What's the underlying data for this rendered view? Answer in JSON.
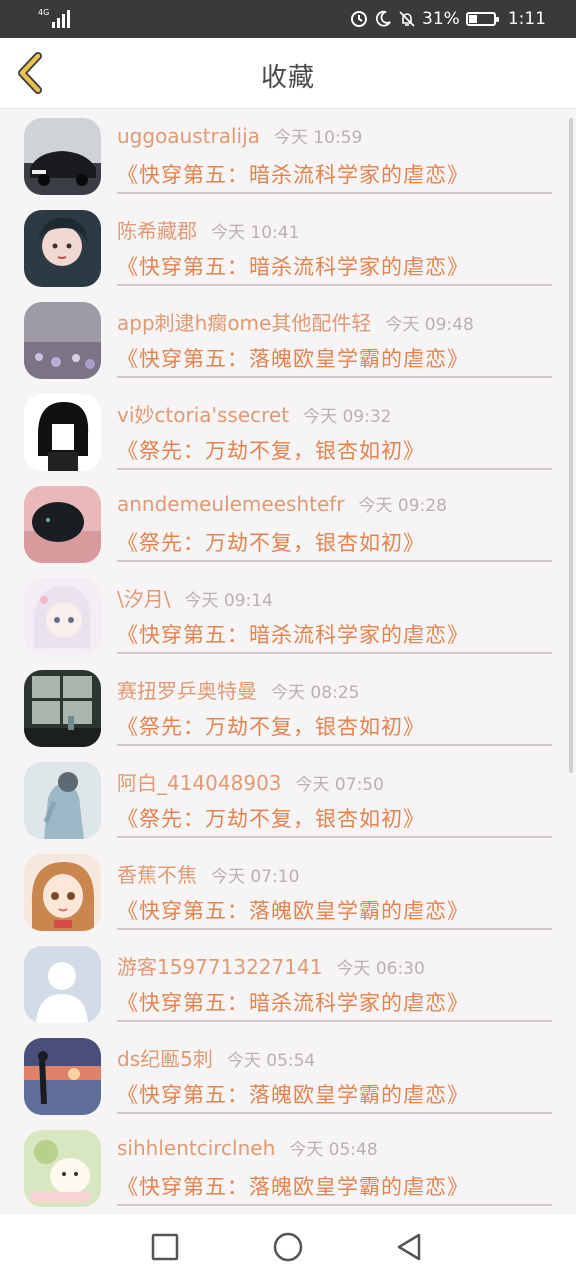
{
  "status_bar": {
    "network": "4G",
    "battery": "31%",
    "battery_level": 0.31,
    "time": "1:11",
    "icons": [
      "signal-icon",
      "data-saver-icon",
      "moon-icon",
      "mute-bell-icon",
      "battery-icon"
    ]
  },
  "header": {
    "title": "收藏",
    "back_icon": "chevron-left-icon"
  },
  "favorites": [
    {
      "user": "uggoaustralija",
      "time": "今天 10:59",
      "book": "《快穿第五：暗杀流科学家的虐恋》"
    },
    {
      "user": "陈希藏郡",
      "time": "今天 10:41",
      "book": "《快穿第五：暗杀流科学家的虐恋》"
    },
    {
      "user": "app刺逮h瘸ome其他配件轻",
      "time": "今天 09:48",
      "book": "《快穿第五：落魄欧皇学霸的虐恋》"
    },
    {
      "user": "vi妙ctoria'ssecret",
      "time": "今天 09:32",
      "book": "《祭先：万劫不复，银杏如初》"
    },
    {
      "user": "anndemeulemeeshtefr",
      "time": "今天 09:28",
      "book": "《祭先：万劫不复，银杏如初》"
    },
    {
      "user": "\\汐月\\",
      "time": "今天 09:14",
      "book": "《快穿第五：暗杀流科学家的虐恋》"
    },
    {
      "user": "赛扭罗乒奥特曼",
      "time": "今天 08:25",
      "book": "《祭先：万劫不复，银杏如初》"
    },
    {
      "user": "阿白_414048903",
      "time": "今天 07:50",
      "book": "《祭先：万劫不复，银杏如初》"
    },
    {
      "user": "香蕉不焦",
      "time": "今天 07:10",
      "book": "《快穿第五：落魄欧皇学霸的虐恋》"
    },
    {
      "user": "游客1597713227141",
      "time": "今天 06:30",
      "book": "《快穿第五：暗杀流科学家的虐恋》"
    },
    {
      "user": "ds纪匭5刺",
      "time": "今天 05:54",
      "book": "《快穿第五：落魄欧皇学霸的虐恋》"
    },
    {
      "user": "sihhlentcirclneh",
      "time": "今天 05:48",
      "book": "《快穿第五：落魄欧皇学霸的虐恋》"
    }
  ],
  "nav": {
    "icons": [
      "square-recents-icon",
      "circle-home-icon",
      "triangle-back-icon"
    ]
  },
  "colors": {
    "accent": "#e38450",
    "username": "#e09a74",
    "time": "#b9b1b1",
    "back_icon": "#e8c24a",
    "background": "#f6f4f4"
  }
}
